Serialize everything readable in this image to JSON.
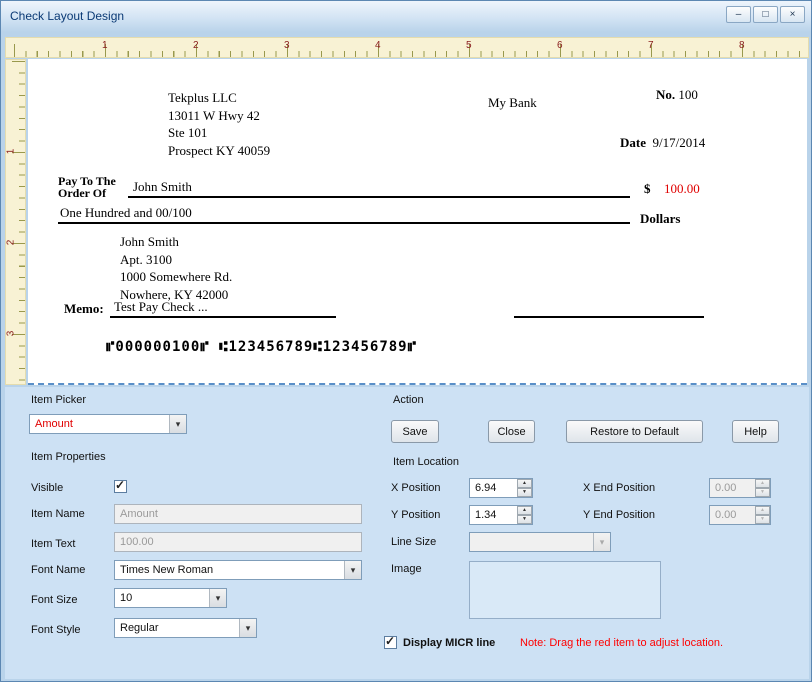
{
  "window": {
    "title": "Check Layout Design",
    "buttons": {
      "minimize": "–",
      "maximize": "□",
      "close": "×"
    }
  },
  "colors": {
    "amount_red": "#e00000",
    "note_red": "#ff0000",
    "panel_blue": "#cde1f4",
    "ruler_bg": "#f8f2d4"
  },
  "rulers": {
    "horizontal": [
      "1",
      "2",
      "3",
      "4",
      "5",
      "6",
      "7",
      "8"
    ],
    "vertical": [
      "1",
      "2",
      "3"
    ]
  },
  "check": {
    "company": [
      "Tekplus LLC",
      "13011 W Hwy 42",
      "Ste 101",
      "Prospect KY 40059"
    ],
    "bank_name": "My Bank",
    "number_label": "No.",
    "number_value": "100",
    "date_label": "Date",
    "date_value": "9/17/2014",
    "pay_to_line1": "Pay To The",
    "pay_to_line2": "Order Of",
    "payee_name": "John Smith",
    "currency_symbol": "$",
    "amount": "100.00",
    "amount_words": "One Hundred and 00/100",
    "dollars_label": "Dollars",
    "payee_address": [
      "John Smith",
      "Apt. 3100",
      "1000 Somewhere Rd.",
      "Nowhere, KY 42000"
    ],
    "memo_label": "Memo:",
    "memo_value": "Test Pay Check ...",
    "micr_line": "⑈000000100⑈ ⑆123456789⑆123456789⑈"
  },
  "panel": {
    "item_picker": {
      "label": "Item Picker",
      "value": "Amount"
    },
    "item_properties": {
      "label": "Item Properties",
      "visible_label": "Visible",
      "visible_checked": true,
      "item_name_label": "Item Name",
      "item_name_value": "Amount",
      "item_text_label": "Item Text",
      "item_text_value": "100.00",
      "font_name_label": "Font Name",
      "font_name_value": "Times New Roman",
      "font_size_label": "Font Size",
      "font_size_value": "10",
      "font_style_label": "Font Style",
      "font_style_value": "Regular"
    },
    "action": {
      "label": "Action",
      "buttons": [
        "Save",
        "Close",
        "Restore to Default",
        "Help"
      ]
    },
    "item_location": {
      "label": "Item Location",
      "x_position_label": "X Position",
      "x_position_value": "6.94",
      "x_end_label": "X End Position",
      "x_end_value": "0.00",
      "y_position_label": "Y Position",
      "y_position_value": "1.34",
      "y_end_label": "Y End Position",
      "y_end_value": "0.00",
      "line_size_label": "Line Size",
      "image_label": "Image"
    },
    "micr_checkbox_label": "Display MICR line",
    "micr_checked": true,
    "note": "Note:  Drag the red item to adjust location."
  },
  "icons": {
    "dropdown_arrow": "▾",
    "spin_up": "▲",
    "spin_down": "▼",
    "checkmark": "✓"
  }
}
